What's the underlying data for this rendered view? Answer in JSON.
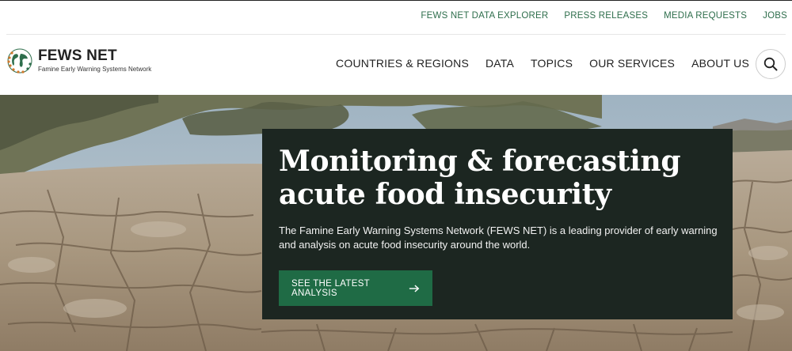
{
  "utility_nav": {
    "items": [
      "FEWS NET DATA EXPLORER",
      "PRESS RELEASES",
      "MEDIA REQUESTS",
      "JOBS"
    ]
  },
  "logo": {
    "title": "FEWS NET",
    "subtitle": "Famine Early Warning Systems Network"
  },
  "main_nav": {
    "items": [
      "COUNTRIES & REGIONS",
      "DATA",
      "TOPICS",
      "OUR SERVICES",
      "ABOUT US"
    ]
  },
  "search": {
    "icon": "search-icon"
  },
  "hero": {
    "title_line1": "Monitoring & forecasting",
    "title_line2": "acute food insecurity",
    "description": "The Famine Early Warning Systems Network (FEWS NET) is a leading provider of early warning and analysis on acute food insecurity around the world.",
    "cta_label": "SEE THE LATEST ANALYSIS",
    "cta_icon": "arrow-right-icon"
  },
  "colors": {
    "accent_green": "#1f6b45",
    "link_green": "#2e6e4c",
    "card_bg": "#1c2621"
  }
}
